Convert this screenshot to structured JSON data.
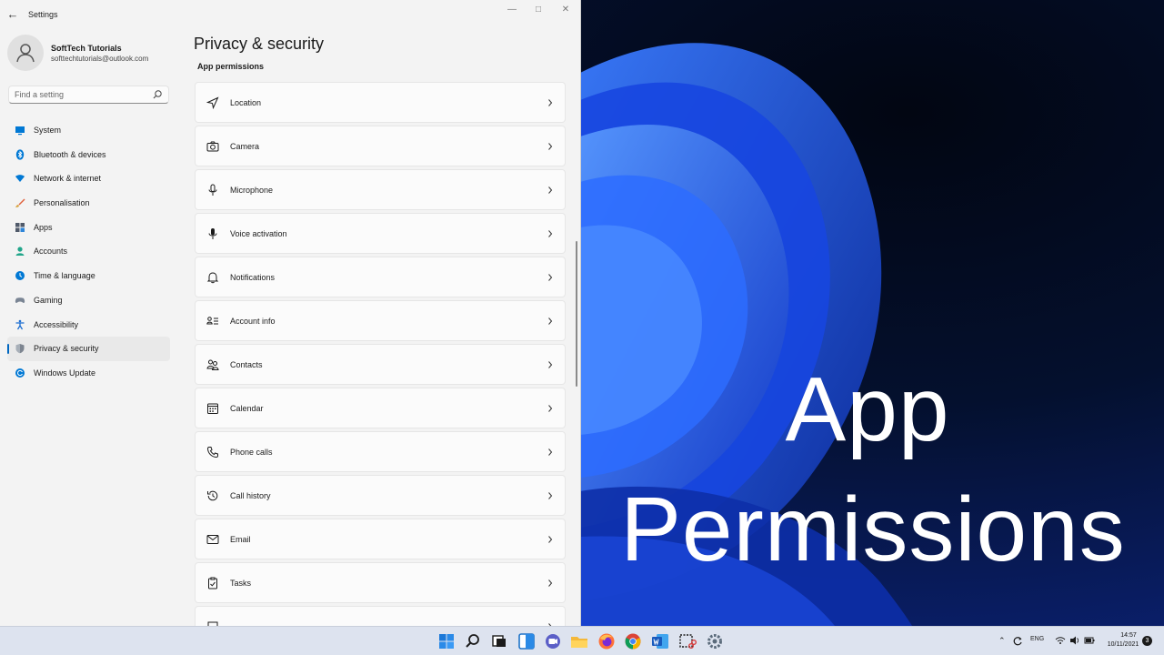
{
  "window": {
    "app_title": "Settings"
  },
  "profile": {
    "name": "SoftTech Tutorials",
    "email": "softtechtutorials@outlook.com"
  },
  "search": {
    "placeholder": "Find a setting",
    "value": ""
  },
  "sidebar": {
    "items": [
      {
        "label": "System",
        "icon": "monitor-icon",
        "color": "#0078d4"
      },
      {
        "label": "Bluetooth & devices",
        "icon": "bluetooth-icon",
        "color": "#0078d4"
      },
      {
        "label": "Network & internet",
        "icon": "wifi-icon",
        "color": "#0078d4"
      },
      {
        "label": "Personalisation",
        "icon": "brush-icon",
        "color": "#e0603a"
      },
      {
        "label": "Apps",
        "icon": "apps-icon",
        "color": "#505a6a"
      },
      {
        "label": "Accounts",
        "icon": "accounts-icon",
        "color": "#21a58a"
      },
      {
        "label": "Time & language",
        "icon": "globe-clock-icon",
        "color": "#0078d4"
      },
      {
        "label": "Gaming",
        "icon": "gamepad-icon",
        "color": "#7a8594"
      },
      {
        "label": "Accessibility",
        "icon": "accessibility-icon",
        "color": "#1b6dd1"
      },
      {
        "label": "Privacy & security",
        "icon": "shield-icon",
        "color": "#7d8590",
        "selected": true
      },
      {
        "label": "Windows Update",
        "icon": "update-icon",
        "color": "#0078d4"
      }
    ]
  },
  "main": {
    "title": "Privacy & security",
    "section_label": "App permissions",
    "permissions": [
      {
        "label": "Location",
        "icon": "location-icon"
      },
      {
        "label": "Camera",
        "icon": "camera-icon"
      },
      {
        "label": "Microphone",
        "icon": "microphone-icon"
      },
      {
        "label": "Voice activation",
        "icon": "voice-activation-icon"
      },
      {
        "label": "Notifications",
        "icon": "bell-icon"
      },
      {
        "label": "Account info",
        "icon": "account-info-icon"
      },
      {
        "label": "Contacts",
        "icon": "contacts-icon"
      },
      {
        "label": "Calendar",
        "icon": "calendar-icon"
      },
      {
        "label": "Phone calls",
        "icon": "phone-icon"
      },
      {
        "label": "Call history",
        "icon": "history-icon"
      },
      {
        "label": "Email",
        "icon": "mail-icon"
      },
      {
        "label": "Tasks",
        "icon": "tasks-icon"
      },
      {
        "label": "",
        "icon": "messaging-icon"
      }
    ]
  },
  "overlay": {
    "line1": "App",
    "line2": "Permissions"
  },
  "taskbar": {
    "apps": [
      "start-icon",
      "search-icon",
      "task-view-icon",
      "widgets-icon",
      "teams-chat-icon",
      "file-explorer-icon",
      "firefox-icon",
      "chrome-icon",
      "word-icon",
      "snipping-tool-icon",
      "settings-icon"
    ],
    "language": "ENG",
    "time": "14:57",
    "date": "10/11/2021",
    "notification_count": "3"
  },
  "colors": {
    "accent": "#0067c0",
    "window_bg": "#f3f3f3",
    "card_bg": "#fbfbfb",
    "taskbar_bg": "#dde3ef"
  }
}
